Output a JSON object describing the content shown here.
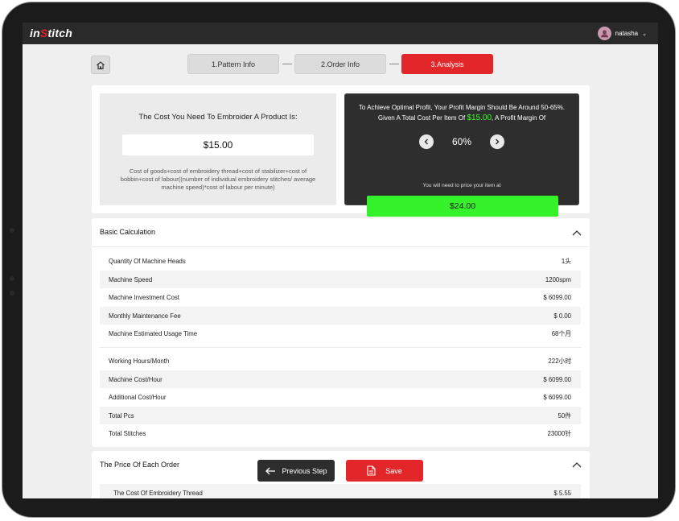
{
  "app": {
    "logo_prefix": "in",
    "logo_s": "S",
    "logo_suffix": "titch"
  },
  "user": {
    "name": "natasha",
    "chevron": "⌄"
  },
  "steps": [
    {
      "label": "1.Pattern Info"
    },
    {
      "label": "2.Order Info"
    },
    {
      "label": "3.Analysis"
    }
  ],
  "cost": {
    "title": "The Cost You Need To Embroider A Product Is:",
    "value": "$15.00",
    "formula": "Cost of goods+cost of embroidery thread+cost of stabilizer+cost of bobbin+cost of labour((number of individual embroidery stitches/ average machine speed)*cost of labour per minute)"
  },
  "profit": {
    "text_line1": "To Achieve Optimal Profit, Your Profit Margin Should Be Around 50-65%. Given A Total Cost Per Item Of ",
    "cost_highlight": "$15.00",
    "text_line2": ", A Profit Margin Of",
    "margin": "60%",
    "note": "You will need to price your item at",
    "price": "$24.00"
  },
  "basic": {
    "title": "Basic Calculation",
    "rows": [
      {
        "label": "Quantity Of Machine Heads",
        "value": "1头"
      },
      {
        "label": "Machine Speed",
        "value": "1200spm"
      },
      {
        "label": "Machine Investment Cost",
        "value": "$ 6099.00"
      },
      {
        "label": "Monthly Maintenance Fee",
        "value": "$ 0.00"
      },
      {
        "label": "Machine Estimated Usage Time",
        "value": "68个月"
      },
      {
        "label": "Working Hours/Month",
        "value": "222小时"
      },
      {
        "label": "Machine Cost/Hour",
        "value": "$ 6099.00"
      },
      {
        "label": "Additional Cost/Hour",
        "value": "$ 6099.00"
      },
      {
        "label": "Total Pcs",
        "value": "50件"
      },
      {
        "label": "Total Stitches",
        "value": "23000针"
      }
    ]
  },
  "order": {
    "title": "The Price Of Each Order",
    "rows": [
      {
        "label": "The Cost Of Embroidery Thread",
        "value": "$ 5.55"
      }
    ]
  },
  "actions": {
    "prev": "Previous Step",
    "save": "Save"
  },
  "colors": {
    "accent": "#e3262a",
    "price_green": "#36f22b",
    "dark": "#2e2e2e"
  },
  "icons": [
    "home-icon",
    "chevron-left-icon",
    "chevron-right-icon",
    "chevron-up-icon",
    "arrow-left-icon",
    "document-icon",
    "user-icon"
  ]
}
